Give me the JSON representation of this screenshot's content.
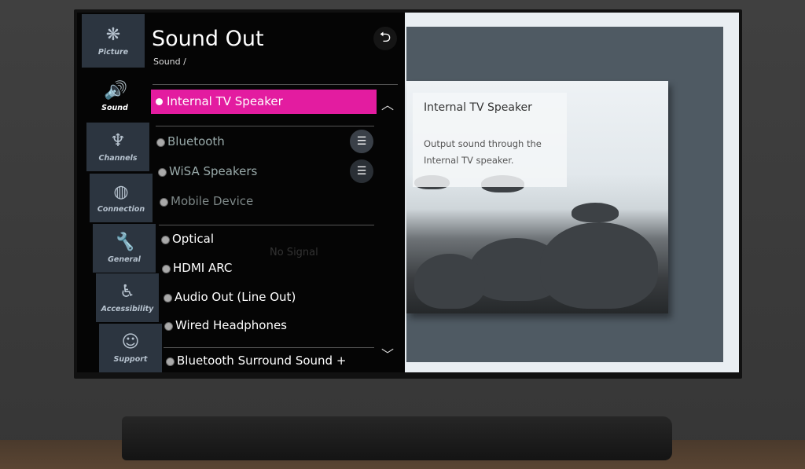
{
  "header": {
    "title": "Sound Out",
    "breadcrumb": "Sound /",
    "back_icon": "back-arrow-icon"
  },
  "sidebar": {
    "items": [
      {
        "label": "Picture",
        "icon": "❋"
      },
      {
        "label": "Sound",
        "icon": "🔊",
        "selected": true
      },
      {
        "label": "Channels",
        "icon": "♆"
      },
      {
        "label": "Connection",
        "icon": "◍"
      },
      {
        "label": "General",
        "icon": "🔧"
      },
      {
        "label": "Accessibility",
        "icon": "♿"
      },
      {
        "label": "Support",
        "icon": "☺"
      }
    ]
  },
  "menu": {
    "selected": "Internal TV Speaker",
    "items": [
      "Bluetooth",
      "WiSA Speakers",
      "Mobile Device",
      "Optical",
      "HDMI ARC",
      "Audio Out (Line Out)",
      "Wired Headphones",
      "Bluetooth Surround Sound +"
    ]
  },
  "background": {
    "no_signal": "No Signal"
  },
  "info": {
    "title": "Internal TV Speaker",
    "description": "Output sound through the Internal TV speaker."
  },
  "colors": {
    "accent": "#e31ca0"
  }
}
